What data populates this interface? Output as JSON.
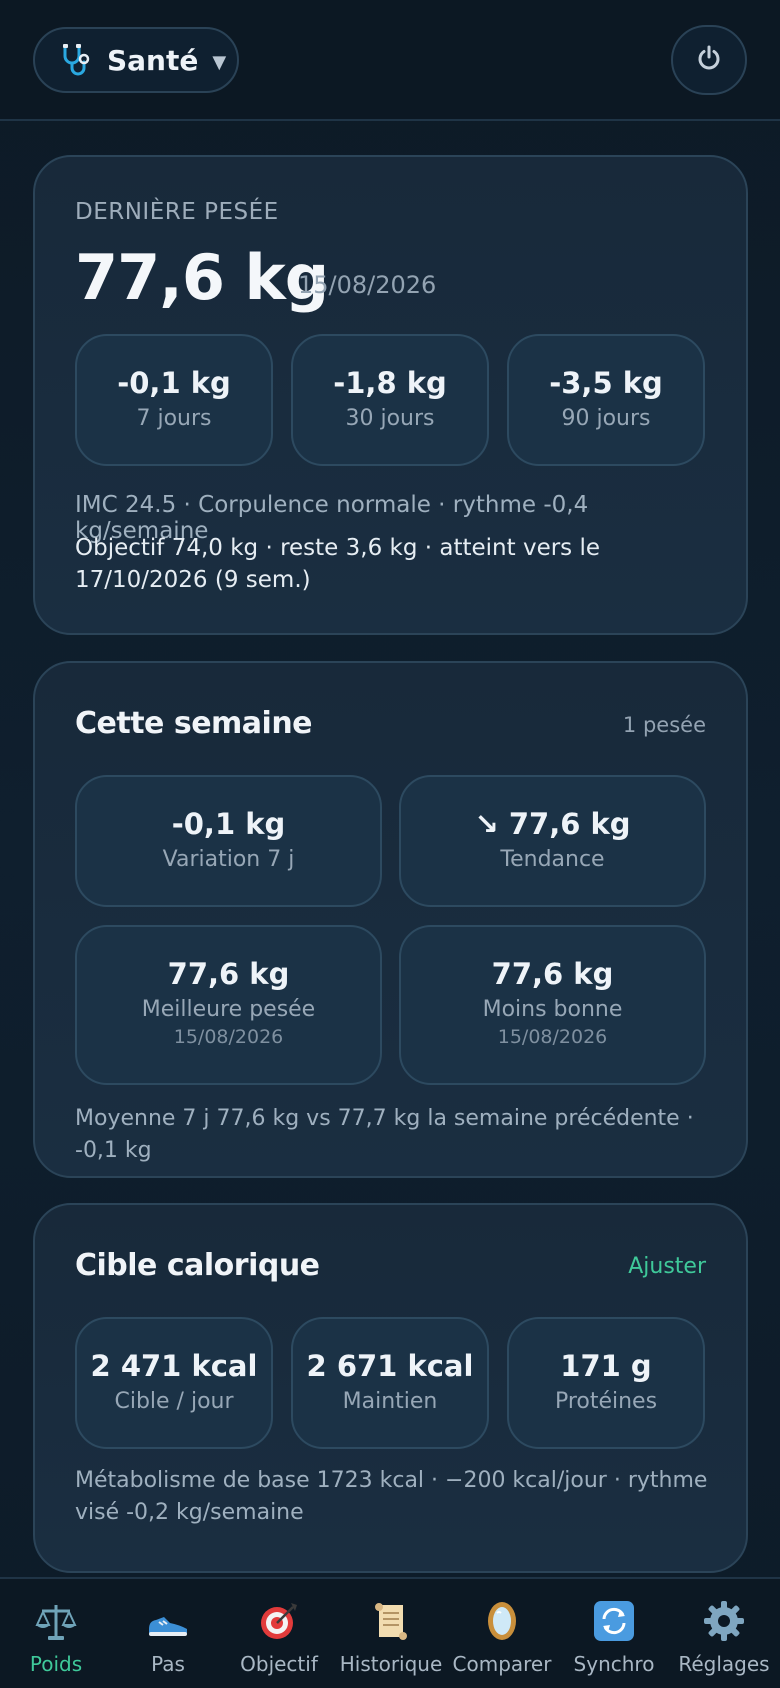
{
  "header": {
    "app_label": "Santé",
    "app_icon": "stethoscope-icon",
    "power_icon": "power-icon"
  },
  "last_weigh_in": {
    "eyebrow": "DERNIÈRE PESÉE",
    "weight": "77,6 kg",
    "date": "15/08/2026",
    "deltas": [
      {
        "value": "-0,1 kg",
        "period": "7 jours"
      },
      {
        "value": "-1,8 kg",
        "period": "30 jours"
      },
      {
        "value": "-3,5 kg",
        "period": "90 jours"
      }
    ],
    "bmi_line": "IMC 24.5 · Corpulence normale · rythme -0,4 kg/semaine",
    "goal_line": "Objectif 74,0 kg · reste 3,6 kg · atteint vers le 17/10/2026 (9 sem.)"
  },
  "this_week": {
    "title": "Cette semaine",
    "count": "1 pesée",
    "stats": [
      {
        "value": "-0,1 kg",
        "label": "Variation 7 j"
      },
      {
        "value": "↘ 77,6 kg",
        "label": "Tendance"
      },
      {
        "value": "77,6 kg",
        "label": "Meilleure pesée",
        "date": "15/08/2026"
      },
      {
        "value": "77,6 kg",
        "label": "Moins bonne",
        "date": "15/08/2026"
      }
    ],
    "footnote": "Moyenne 7 j 77,6 kg vs 77,7 kg la semaine précédente · -0,1 kg"
  },
  "calorie_target": {
    "title": "Cible calorique",
    "adjust_label": "Ajuster",
    "stats": [
      {
        "value": "2 471 kcal",
        "label": "Cible / jour"
      },
      {
        "value": "2 671 kcal",
        "label": "Maintien"
      },
      {
        "value": "171 g",
        "label": "Protéines"
      }
    ],
    "footnote": "Métabolisme de base 1723 kcal · −200 kcal/jour · rythme visé -0,2 kg/semaine"
  },
  "nav": {
    "items": [
      {
        "label": "Poids",
        "icon": "scale-icon",
        "active": true
      },
      {
        "label": "Pas",
        "icon": "sneaker-icon",
        "active": false
      },
      {
        "label": "Objectif",
        "icon": "target-icon",
        "active": false
      },
      {
        "label": "Historique",
        "icon": "scroll-icon",
        "active": false
      },
      {
        "label": "Comparer",
        "icon": "mirror-icon",
        "active": false
      },
      {
        "label": "Synchro",
        "icon": "sync-icon",
        "active": false
      },
      {
        "label": "Réglages",
        "icon": "gear-icon",
        "active": false
      }
    ]
  },
  "colors": {
    "accent": "#3fc99a",
    "background": "#0f1f2e",
    "card": "#1a2e41"
  }
}
